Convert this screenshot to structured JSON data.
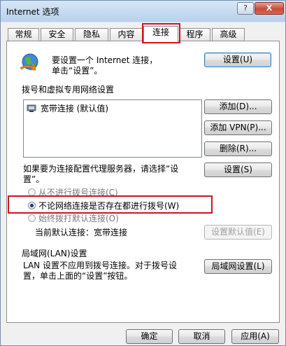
{
  "window": {
    "title": "Internet 选项",
    "help_label": "?",
    "close_label": "X"
  },
  "tabs": [
    {
      "label": "常规"
    },
    {
      "label": "安全"
    },
    {
      "label": "隐私"
    },
    {
      "label": "内容"
    },
    {
      "label": "连接"
    },
    {
      "label": "程序"
    },
    {
      "label": "高级"
    }
  ],
  "active_tab": "连接",
  "setup": {
    "text": "要设置一个 Internet 连接，单击“设置”。",
    "button_label": "设置(U)"
  },
  "dialup": {
    "section_label": "拨号和虚拟专用网络设置",
    "list_items": [
      {
        "label": "宽带连接 (默认值)"
      }
    ],
    "add_label": "添加(D)...",
    "add_vpn_label": "添加 VPN(P)...",
    "delete_label": "删除(R)...",
    "proxy_text": "如果要为连接配置代理服务器，请选择“设置”。",
    "settings_label": "设置(S)"
  },
  "dial_options": {
    "option_never": "从不进行拨号连接(C)",
    "option_always": "不论网络连接是否存在都进行拨号(W)",
    "option_default": "始终拨打默认连接(O)",
    "selected": "option_always",
    "current_default_label": "当前默认连接：宽带连接",
    "set_default_label": "设置默认值(E)"
  },
  "lan": {
    "section_label": "局域网(LAN)设置",
    "text": "LAN 设置不应用到拨号连接。对于拨号设置，单击上面的“设置”按钮。",
    "button_label": "局域网设置(L)"
  },
  "footer": {
    "ok_label": "确定",
    "cancel_label": "取消",
    "apply_label": "应用(A)"
  },
  "colors": {
    "highlight_red": "#d0141b"
  }
}
